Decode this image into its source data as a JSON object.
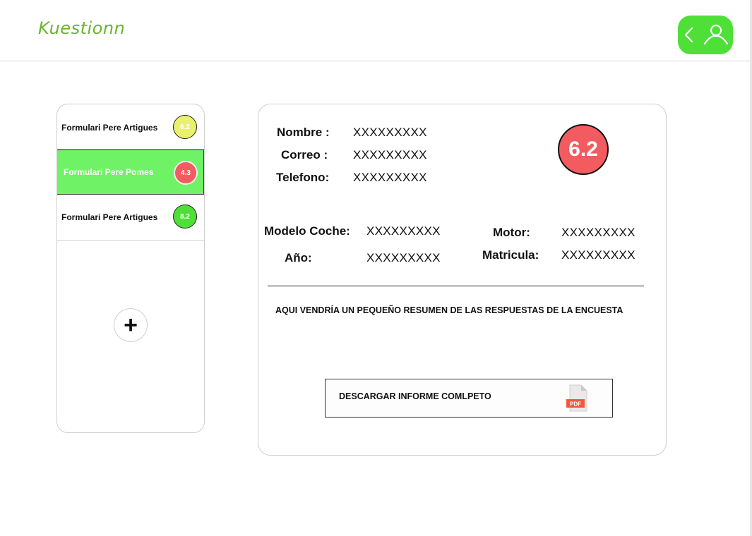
{
  "header": {
    "brand": "Kuestionn"
  },
  "forms": [
    {
      "name": "Formulari Pere Artigues",
      "score": "6.2",
      "badge_color": "#eaf16a",
      "selected": false
    },
    {
      "name": "Formulari Pere Pomes",
      "score": "4.3",
      "badge_color": "#f25c60",
      "selected": true
    },
    {
      "name": "Formulari Pere Artigues",
      "score": "8.2",
      "badge_color": "#4ee036",
      "selected": false
    }
  ],
  "add_button": {
    "symbol": "+"
  },
  "detail": {
    "score": "6.2",
    "nombre_label": "Nombre :",
    "nombre_value": "XXXXXXXXX",
    "correo_label": "Correo :",
    "correo_value": "XXXXXXXXX",
    "telefono_label": "Telefono:",
    "telefono_value": "XXXXXXXXX",
    "modelo_label": "Modelo Coche:",
    "modelo_value": "XXXXXXXXX",
    "anio_label": "Año:",
    "anio_value": "XXXXXXXXX",
    "motor_label": "Motor:",
    "motor_value": "XXXXXXXXX",
    "matricula_label": "Matricula:",
    "matricula_value": "XXXXXXXXX",
    "summary": "AQUI VENDRÍA UN PEQUEÑO RESUMEN DE LAS RESPUESTAS DE LA ENCUESTA",
    "download_label": "DESCARGAR INFORME COMLPETO",
    "pdf_text": "PDF"
  },
  "colors": {
    "brand": "#6ab42e",
    "accent_green": "#4ee036",
    "selected_row": "#6ff266",
    "red": "#f25c60",
    "yellow": "#eaf16a"
  }
}
